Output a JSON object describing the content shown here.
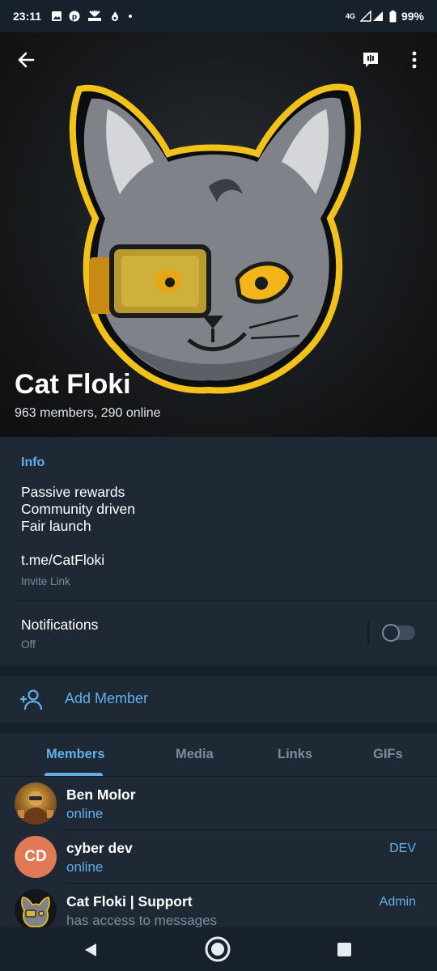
{
  "status_bar": {
    "time": "23:11",
    "network": "4G",
    "battery": "99%",
    "icons": [
      "gallery-icon",
      "pinterest-icon",
      "cnbc-icon",
      "fire-icon",
      "dot-icon"
    ]
  },
  "header": {
    "title": "Cat Floki",
    "subtitle": "963 members, 290 online",
    "icons": [
      "back-arrow-icon",
      "voice-chat-icon",
      "more-vertical-icon"
    ]
  },
  "info": {
    "label": "Info",
    "description": [
      "Passive rewards",
      "Community driven",
      "Fair launch"
    ],
    "link": "t.me/CatFloki",
    "link_caption": "Invite Link",
    "notifications_label": "Notifications",
    "notifications_state": "Off",
    "notifications_enabled": false
  },
  "add_member": {
    "label": "Add Member",
    "icon": "add-person-icon"
  },
  "tabs": [
    {
      "label": "Members",
      "active": true
    },
    {
      "label": "Media",
      "active": false
    },
    {
      "label": "Links",
      "active": false
    },
    {
      "label": "GIFs",
      "active": false
    }
  ],
  "members": [
    {
      "name": "Ben Molor",
      "status": "online",
      "role": "",
      "avatar": "photo"
    },
    {
      "name": "cyber dev",
      "status": "online",
      "role": "DEV",
      "avatar_initials": "CD",
      "avatar_color": "#e07a55"
    },
    {
      "name": "Cat Floki | Support",
      "status": "has access to messages",
      "role": "Admin",
      "avatar": "cat-logo"
    }
  ],
  "colors": {
    "accent": "#5fb0ea",
    "background": "#1f2936",
    "separator": "#17212b",
    "muted_text": "#7d8b99",
    "logo_yellow": "#f2c21b"
  },
  "nav": {
    "icons": [
      "nav-back-icon",
      "nav-home-icon",
      "nav-recents-icon"
    ]
  }
}
